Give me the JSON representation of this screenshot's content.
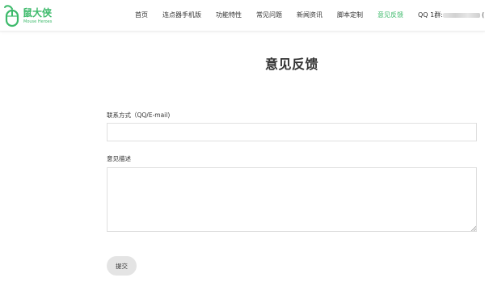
{
  "brand": {
    "name": "鼠大侠",
    "subtitle": "Mouse Heroes",
    "accent_color": "#3dba6b",
    "logo_icon": "mouse-icon"
  },
  "nav": {
    "items": [
      {
        "label": "首页",
        "active": false
      },
      {
        "label": "连点器手机版",
        "active": false
      },
      {
        "label": "功能特性",
        "active": false
      },
      {
        "label": "常见问题",
        "active": false
      },
      {
        "label": "新闻资讯",
        "active": false
      },
      {
        "label": "脚本定制",
        "active": false
      },
      {
        "label": "意见反馈",
        "active": true
      }
    ],
    "qq_label": "QQ 1群:",
    "qq_tail": "("
  },
  "page": {
    "title": "意见反馈"
  },
  "form": {
    "contact_label": "联系方式（QQ/E-mail)",
    "contact_value": "",
    "contact_placeholder": "",
    "description_label": "意见描述",
    "description_value": "",
    "description_placeholder": "",
    "submit_label": "提交"
  }
}
